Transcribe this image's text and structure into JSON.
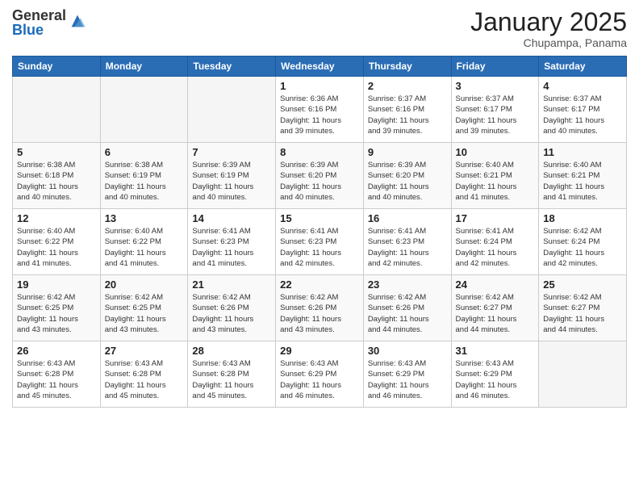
{
  "logo": {
    "general": "General",
    "blue": "Blue"
  },
  "calendar": {
    "title": "January 2025",
    "location": "Chupampa, Panama",
    "headers": [
      "Sunday",
      "Monday",
      "Tuesday",
      "Wednesday",
      "Thursday",
      "Friday",
      "Saturday"
    ],
    "weeks": [
      [
        {
          "day": "",
          "info": ""
        },
        {
          "day": "",
          "info": ""
        },
        {
          "day": "",
          "info": ""
        },
        {
          "day": "1",
          "info": "Sunrise: 6:36 AM\nSunset: 6:16 PM\nDaylight: 11 hours\nand 39 minutes."
        },
        {
          "day": "2",
          "info": "Sunrise: 6:37 AM\nSunset: 6:16 PM\nDaylight: 11 hours\nand 39 minutes."
        },
        {
          "day": "3",
          "info": "Sunrise: 6:37 AM\nSunset: 6:17 PM\nDaylight: 11 hours\nand 39 minutes."
        },
        {
          "day": "4",
          "info": "Sunrise: 6:37 AM\nSunset: 6:17 PM\nDaylight: 11 hours\nand 40 minutes."
        }
      ],
      [
        {
          "day": "5",
          "info": "Sunrise: 6:38 AM\nSunset: 6:18 PM\nDaylight: 11 hours\nand 40 minutes."
        },
        {
          "day": "6",
          "info": "Sunrise: 6:38 AM\nSunset: 6:19 PM\nDaylight: 11 hours\nand 40 minutes."
        },
        {
          "day": "7",
          "info": "Sunrise: 6:39 AM\nSunset: 6:19 PM\nDaylight: 11 hours\nand 40 minutes."
        },
        {
          "day": "8",
          "info": "Sunrise: 6:39 AM\nSunset: 6:20 PM\nDaylight: 11 hours\nand 40 minutes."
        },
        {
          "day": "9",
          "info": "Sunrise: 6:39 AM\nSunset: 6:20 PM\nDaylight: 11 hours\nand 40 minutes."
        },
        {
          "day": "10",
          "info": "Sunrise: 6:40 AM\nSunset: 6:21 PM\nDaylight: 11 hours\nand 41 minutes."
        },
        {
          "day": "11",
          "info": "Sunrise: 6:40 AM\nSunset: 6:21 PM\nDaylight: 11 hours\nand 41 minutes."
        }
      ],
      [
        {
          "day": "12",
          "info": "Sunrise: 6:40 AM\nSunset: 6:22 PM\nDaylight: 11 hours\nand 41 minutes."
        },
        {
          "day": "13",
          "info": "Sunrise: 6:40 AM\nSunset: 6:22 PM\nDaylight: 11 hours\nand 41 minutes."
        },
        {
          "day": "14",
          "info": "Sunrise: 6:41 AM\nSunset: 6:23 PM\nDaylight: 11 hours\nand 41 minutes."
        },
        {
          "day": "15",
          "info": "Sunrise: 6:41 AM\nSunset: 6:23 PM\nDaylight: 11 hours\nand 42 minutes."
        },
        {
          "day": "16",
          "info": "Sunrise: 6:41 AM\nSunset: 6:23 PM\nDaylight: 11 hours\nand 42 minutes."
        },
        {
          "day": "17",
          "info": "Sunrise: 6:41 AM\nSunset: 6:24 PM\nDaylight: 11 hours\nand 42 minutes."
        },
        {
          "day": "18",
          "info": "Sunrise: 6:42 AM\nSunset: 6:24 PM\nDaylight: 11 hours\nand 42 minutes."
        }
      ],
      [
        {
          "day": "19",
          "info": "Sunrise: 6:42 AM\nSunset: 6:25 PM\nDaylight: 11 hours\nand 43 minutes."
        },
        {
          "day": "20",
          "info": "Sunrise: 6:42 AM\nSunset: 6:25 PM\nDaylight: 11 hours\nand 43 minutes."
        },
        {
          "day": "21",
          "info": "Sunrise: 6:42 AM\nSunset: 6:26 PM\nDaylight: 11 hours\nand 43 minutes."
        },
        {
          "day": "22",
          "info": "Sunrise: 6:42 AM\nSunset: 6:26 PM\nDaylight: 11 hours\nand 43 minutes."
        },
        {
          "day": "23",
          "info": "Sunrise: 6:42 AM\nSunset: 6:26 PM\nDaylight: 11 hours\nand 44 minutes."
        },
        {
          "day": "24",
          "info": "Sunrise: 6:42 AM\nSunset: 6:27 PM\nDaylight: 11 hours\nand 44 minutes."
        },
        {
          "day": "25",
          "info": "Sunrise: 6:42 AM\nSunset: 6:27 PM\nDaylight: 11 hours\nand 44 minutes."
        }
      ],
      [
        {
          "day": "26",
          "info": "Sunrise: 6:43 AM\nSunset: 6:28 PM\nDaylight: 11 hours\nand 45 minutes."
        },
        {
          "day": "27",
          "info": "Sunrise: 6:43 AM\nSunset: 6:28 PM\nDaylight: 11 hours\nand 45 minutes."
        },
        {
          "day": "28",
          "info": "Sunrise: 6:43 AM\nSunset: 6:28 PM\nDaylight: 11 hours\nand 45 minutes."
        },
        {
          "day": "29",
          "info": "Sunrise: 6:43 AM\nSunset: 6:29 PM\nDaylight: 11 hours\nand 46 minutes."
        },
        {
          "day": "30",
          "info": "Sunrise: 6:43 AM\nSunset: 6:29 PM\nDaylight: 11 hours\nand 46 minutes."
        },
        {
          "day": "31",
          "info": "Sunrise: 6:43 AM\nSunset: 6:29 PM\nDaylight: 11 hours\nand 46 minutes."
        },
        {
          "day": "",
          "info": ""
        }
      ]
    ]
  }
}
